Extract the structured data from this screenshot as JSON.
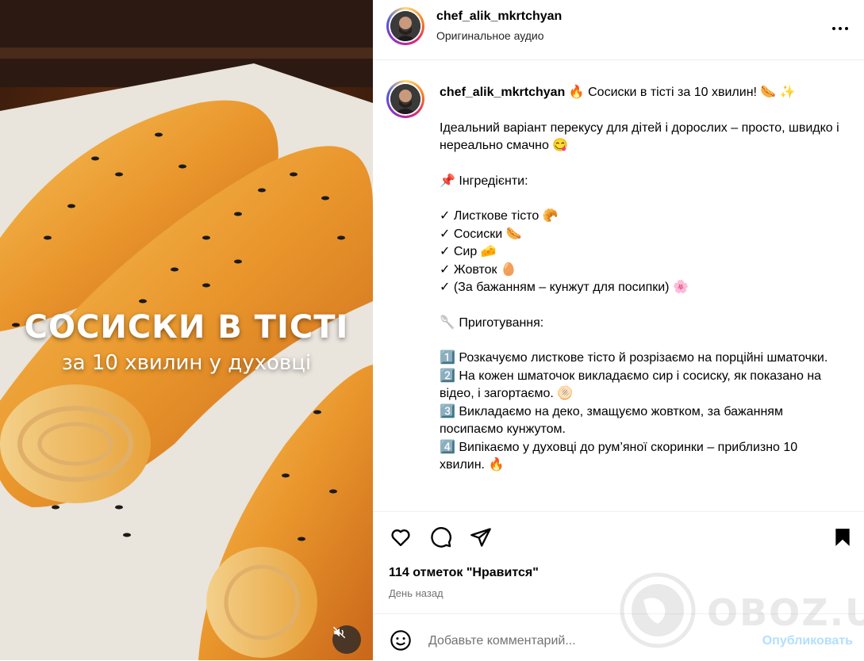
{
  "media": {
    "overlay_title": "СОСИСКИ В ТІСТІ",
    "overlay_subtitle": "за 10 хвилин у духовці",
    "mute_icon": "speaker-muted-icon"
  },
  "header": {
    "username": "chef_alik_mkrtchyan",
    "audio": "Оригинальное аудио",
    "more_icon": "more-horizontal-icon"
  },
  "caption": {
    "username": "chef_alik_mkrtchyan",
    "title": " 🔥  Сосиски в тісті за 10 хвилин! 🌭 ✨",
    "lines": [
      "Ідеальний варіант перекусу для дітей і дорослих – просто, швидко і нереально смачно 😋",
      "📌  Інгредієнти:",
      "✓ Листкове тісто 🥐\n✓ Сосиски 🌭\n✓ Сир 🧀\n✓ Жовток 🥚\n✓ (За бажанням – кунжут для посипки) 🌸",
      "🥄  Приготування:",
      "1️⃣  Розкачуємо листкове тісто й розрізаємо на порційні шматочки.\n2️⃣  На кожен шматочок викладаємо сир і сосиску, як показано на відео, і загортаємо. 🫓\n3️⃣  Викладаємо на деко, змащуємо жовтком, за бажанням посипаємо кунжутом.\n4️⃣  Випікаємо у духовці до рум’яної скоринки – приблизно 10 хвилин. 🔥"
    ]
  },
  "actions": {
    "like_icon": "heart-icon",
    "comment_icon": "comment-icon",
    "share_icon": "paper-plane-icon",
    "save_icon": "bookmark-filled-icon",
    "likes": "114 отметок \"Нравится\"",
    "date": "День назад"
  },
  "comment": {
    "emoji_icon": "smiley-icon",
    "placeholder": "Добавьте комментарий...",
    "publish": "Опубликовать"
  },
  "watermark": "OBOZ.UA"
}
